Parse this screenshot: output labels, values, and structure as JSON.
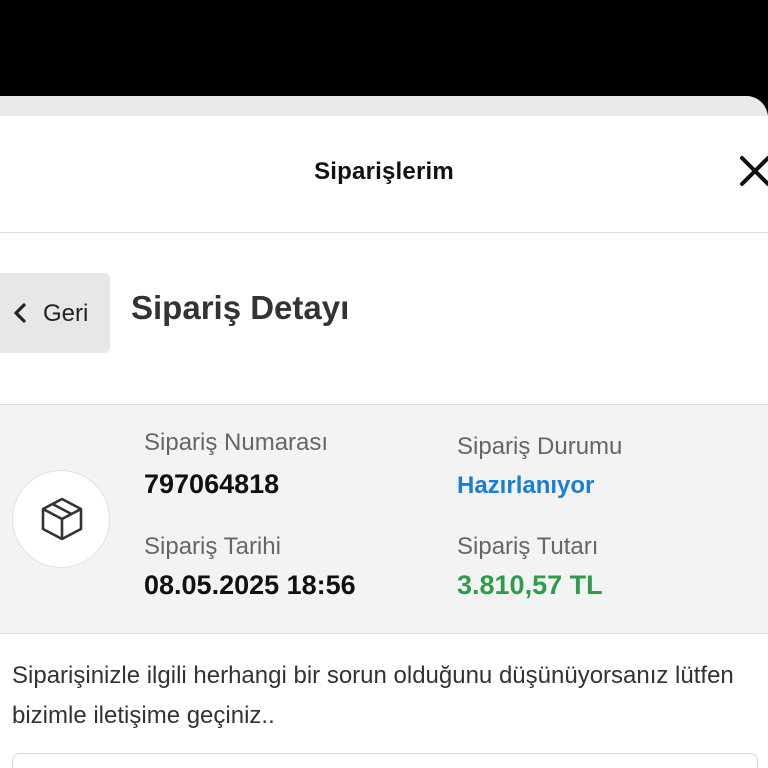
{
  "header": {
    "title": "Siparişlerim"
  },
  "subheader": {
    "back_label": "Geri",
    "page_title": "Sipariş Detayı"
  },
  "order": {
    "number_label": "Sipariş Numarası",
    "number_value": "797064818",
    "status_label": "Sipariş Durumu",
    "status_value": "Hazırlanıyor",
    "date_label": "Sipariş Tarihi",
    "date_value": "08.05.2025 18:56",
    "total_label": "Sipariş Tutarı",
    "total_value": "3.810,57 TL"
  },
  "help": {
    "text": "Siparişinizle ilgili herhangi bir sorun olduğunu düşünüyorsanız lütfen bizimle iletişime geçiniz.."
  },
  "colors": {
    "status": "#1a7fd4",
    "total": "#2e9c4b",
    "panel_bg": "#f3f3f3"
  },
  "icons": {
    "close": "close-icon",
    "back": "chevron-left-icon",
    "order": "package-box-icon"
  }
}
